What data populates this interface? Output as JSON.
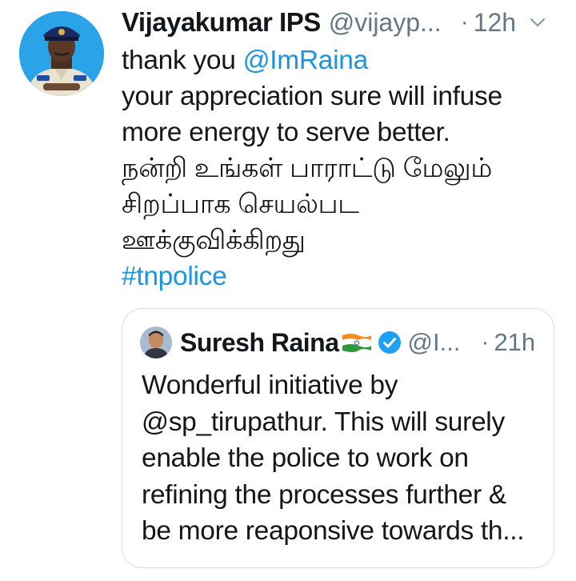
{
  "tweet": {
    "author_name": "Vijayakumar IPS",
    "author_handle": "@vijayp...",
    "dot": "·",
    "time": "12h",
    "avatar_icon": "police-officer-avatar",
    "text_lines": [
      {
        "text": "thank you ",
        "mention": "@ImRaina"
      },
      {
        "text": "your appreciation sure will infuse"
      },
      {
        "text": "more energy to serve better."
      },
      {
        "text": "நன்றி உங்கள் பாராட்டு மேலும்"
      },
      {
        "text": "சிறப்பாக செயல்பட"
      },
      {
        "text": "ஊக்குவிக்கிறது"
      }
    ],
    "hashtag": "#tnpolice",
    "link_color": "#1b95e0"
  },
  "quote": {
    "author_name": "Suresh Raina",
    "author_handle": "@I...",
    "dot": "·",
    "time": "21h",
    "flag_icon": "india-flag-icon",
    "verified_icon": "verified-badge-icon",
    "text_lines": [
      "Wonderful initiative by",
      "@sp_tirupathur. This will surely",
      "enable the police to work on",
      "refining the processes further &",
      "be more reaponsive towards th..."
    ]
  }
}
